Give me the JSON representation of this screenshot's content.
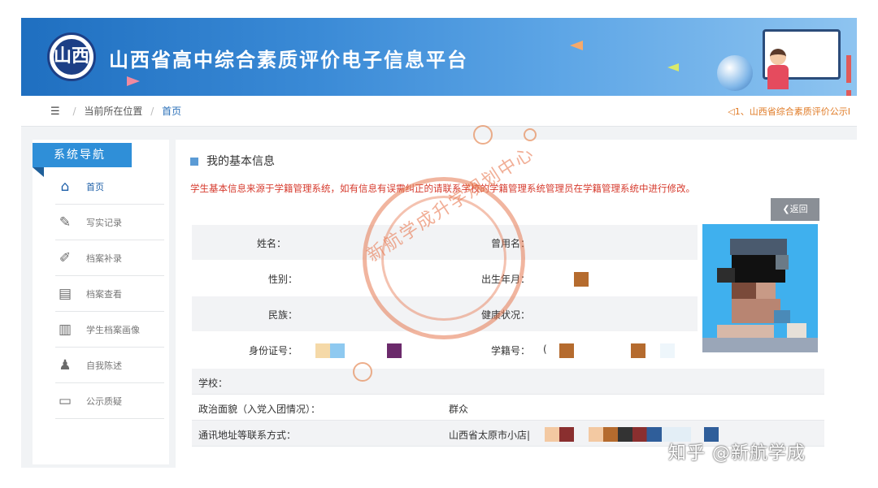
{
  "header": {
    "logo_text": "山西",
    "title": "山西省高中综合素质评价电子信息平台"
  },
  "breadcrumb": {
    "prefix": "当前所在位置",
    "current": "首页",
    "notice": "◁1、山西省综合素质评价公示I"
  },
  "sidebar": {
    "title": "系统导航",
    "items": [
      {
        "label": "首页",
        "icon": "home-icon",
        "glyph": "⌂"
      },
      {
        "label": "写实记录",
        "icon": "edit-icon",
        "glyph": "✎"
      },
      {
        "label": "档案补录",
        "icon": "pencil-circle-icon",
        "glyph": "✐"
      },
      {
        "label": "档案查看",
        "icon": "calendar-icon",
        "glyph": "▤"
      },
      {
        "label": "学生档案画像",
        "icon": "report-icon",
        "glyph": "▥"
      },
      {
        "label": "自我陈述",
        "icon": "user-icon",
        "glyph": "♟"
      },
      {
        "label": "公示质疑",
        "icon": "inbox-icon",
        "glyph": "▭"
      }
    ]
  },
  "main": {
    "section_title": "我的基本信息",
    "warning": "学生基本信息来源于学籍管理系统，如有信息有误需纠正的请联系学校的学籍管理系统管理员在学籍管理系统中进行修改。",
    "back_label": "❮返回",
    "fields": {
      "name": "姓名：",
      "former_name": "曾用名：",
      "gender": "性别：",
      "birth": "出生年月：",
      "ethnicity": "民族：",
      "health": "健康状况：",
      "id_no": "身份证号：",
      "student_no": "学籍号：",
      "student_no_prefix": "(",
      "school": "学校：",
      "political": "政治面貌（入党入团情况）：",
      "political_value": "群众",
      "address": "通讯地址等联系方式：",
      "address_value": "山西省太原市小店|"
    }
  },
  "watermark": {
    "stamp_text": "新航学成升学规划中心",
    "corner_text": "知乎 @新航学成"
  },
  "colors": {
    "header_blue": "#2f7fd0",
    "nav_blue": "#2f8fd8",
    "warning_red": "#d63a2d",
    "notice_orange": "#e07b26"
  }
}
